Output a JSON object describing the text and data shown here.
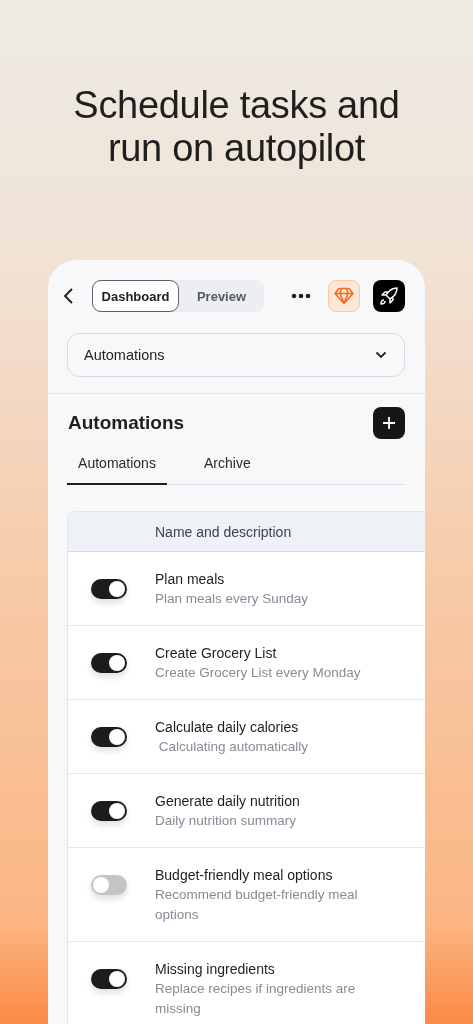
{
  "headline": "Schedule tasks and run on autopilot",
  "toolbar": {
    "view_switch": [
      {
        "label": "Dashboard",
        "selected": true
      },
      {
        "label": "Preview",
        "selected": false
      }
    ]
  },
  "dropdown": {
    "value": "Automations"
  },
  "section": {
    "title": "Automations"
  },
  "tabs": [
    {
      "label": "Automations",
      "selected": true
    },
    {
      "label": "Archive",
      "selected": false
    }
  ],
  "table": {
    "columns": [
      "Name and description"
    ],
    "rows": [
      {
        "name": "Plan meals",
        "description": "Plan meals every Sunday",
        "on": true
      },
      {
        "name": "Create Grocery List",
        "description": "Create Grocery List every Monday",
        "on": true
      },
      {
        "name": "Calculate daily calories",
        "description": " Calculating automatically",
        "on": true
      },
      {
        "name": "Generate daily nutrition",
        "description": "Daily nutrition summary",
        "on": true
      },
      {
        "name": "Budget-friendly meal options",
        "description": "Recommend budget-friendly meal options",
        "on": false
      },
      {
        "name": "Missing ingredients",
        "description": "Replace recipes if ingredients are missing",
        "on": true
      }
    ]
  }
}
